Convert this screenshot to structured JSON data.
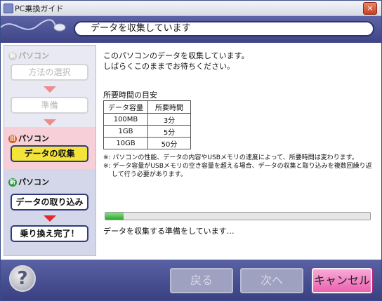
{
  "window": {
    "title": "PC乗換ガイド",
    "close_glyph": "×"
  },
  "header": {
    "title": "データを収集しています"
  },
  "sidebar": {
    "old_pc": {
      "badge": "旧",
      "label": "パソコン"
    },
    "new_pc": {
      "badge": "新",
      "label": "パソコン"
    },
    "top_pc": {
      "badge": "新",
      "label": "パソコン"
    },
    "steps": {
      "method": "方法の選択",
      "prepare": "準備",
      "collect": "データの収集",
      "import": "データの取り込み",
      "finish": "乗り換え完了！"
    }
  },
  "main": {
    "message_line1": "このパソコンのデータを収集しています。",
    "message_line2": "しばらくこのままでお待ちください。",
    "table_title": "所要時間の目安",
    "table": {
      "headers": [
        "データ容量",
        "所要時間"
      ],
      "rows": [
        [
          "100MB",
          "3分"
        ],
        [
          "1GB",
          "5分"
        ],
        [
          "10GB",
          "50分"
        ]
      ]
    },
    "note1": "※: パソコンの性能、データの内容やUSBメモリの速度によって、所要時間は変わります。",
    "note2": "※: データ容量がUSBメモリの空き容量を超える場合、データの収集と取り込みを複数回繰り返して行う必要があります。",
    "progress_percent": 7,
    "status": "データを収集する準備をしています…"
  },
  "footer": {
    "help_glyph": "?",
    "back_label": "戻る",
    "next_label": "次へ",
    "cancel_label": "キャンセル"
  }
}
